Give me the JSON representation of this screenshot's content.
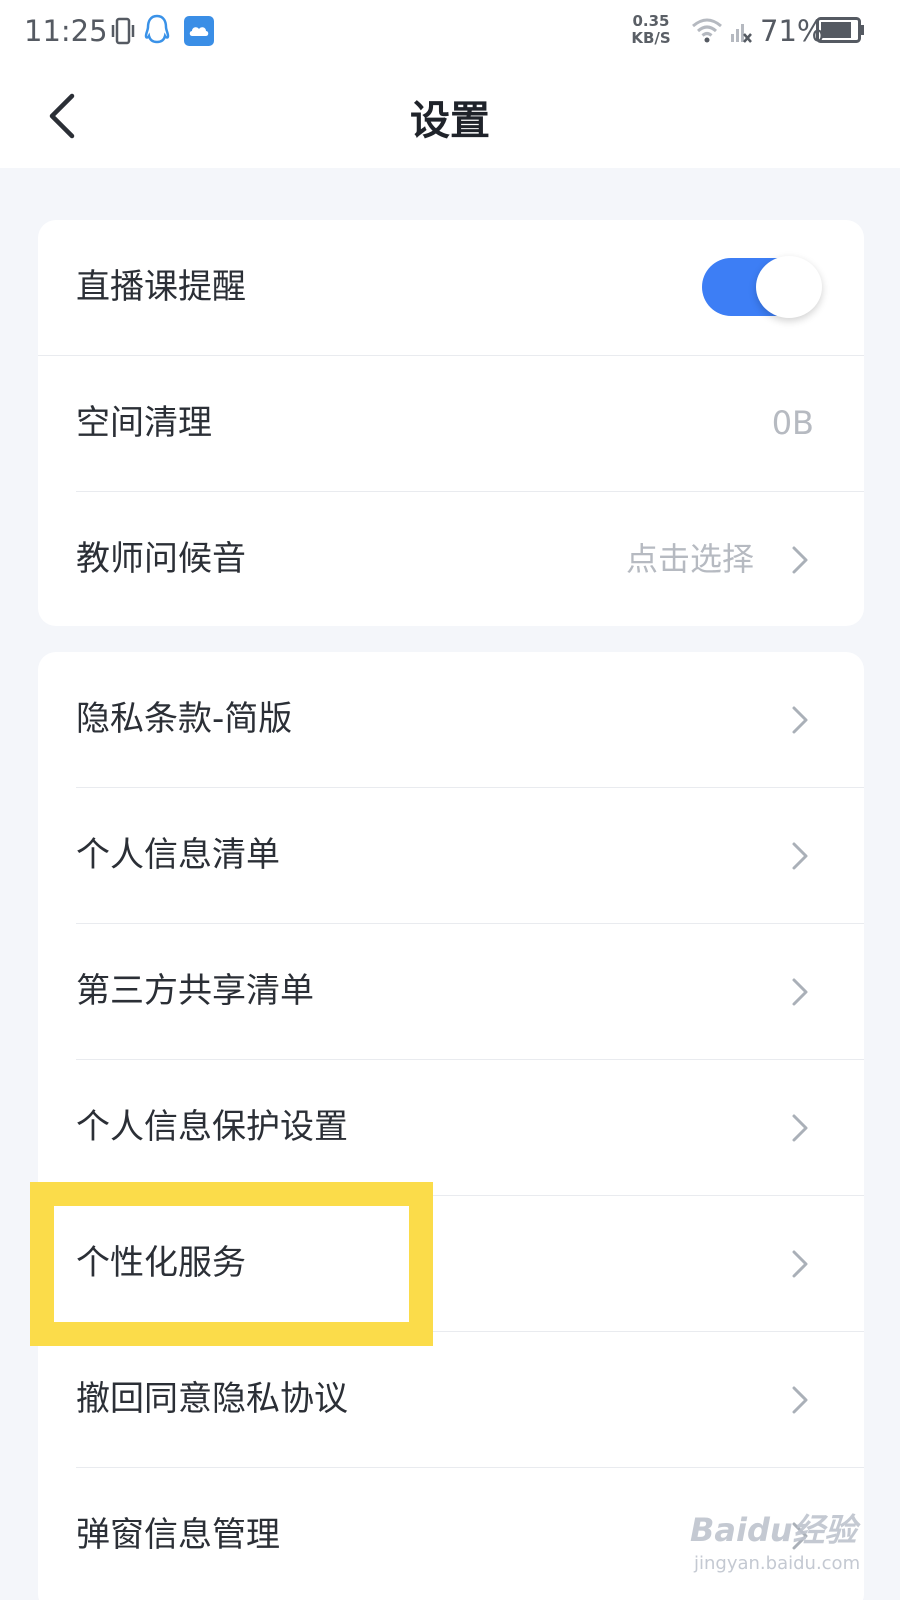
{
  "status_bar": {
    "time": "11:25",
    "net_speed_value": "0.35",
    "net_speed_unit": "KB/S",
    "battery": "71%",
    "icons": [
      "vibrate-icon",
      "qq-icon",
      "cloud-app-icon",
      "wifi-icon",
      "signal-off-icon",
      "battery-icon"
    ]
  },
  "header": {
    "title": "设置",
    "back_icon": "chevron-left-icon"
  },
  "group1": {
    "items": [
      {
        "label": "直播课提醒",
        "toggle_on": true
      },
      {
        "label": "空间清理",
        "value": "0B"
      },
      {
        "label": "教师问候音",
        "value": "点击选择"
      }
    ]
  },
  "group2": {
    "items": [
      {
        "label": "隐私条款-简版"
      },
      {
        "label": "个人信息清单"
      },
      {
        "label": "第三方共享清单"
      },
      {
        "label": "个人信息保护设置"
      },
      {
        "label": "个性化服务"
      },
      {
        "label": "撤回同意隐私协议"
      },
      {
        "label": "弹窗信息管理"
      }
    ]
  },
  "watermark": {
    "main": "Baidu经验",
    "sub": "jingyan.baidu.com"
  },
  "colors": {
    "accent": "#3d7ef5",
    "highlight": "#fbdc4a",
    "background": "#f4f6fa"
  }
}
